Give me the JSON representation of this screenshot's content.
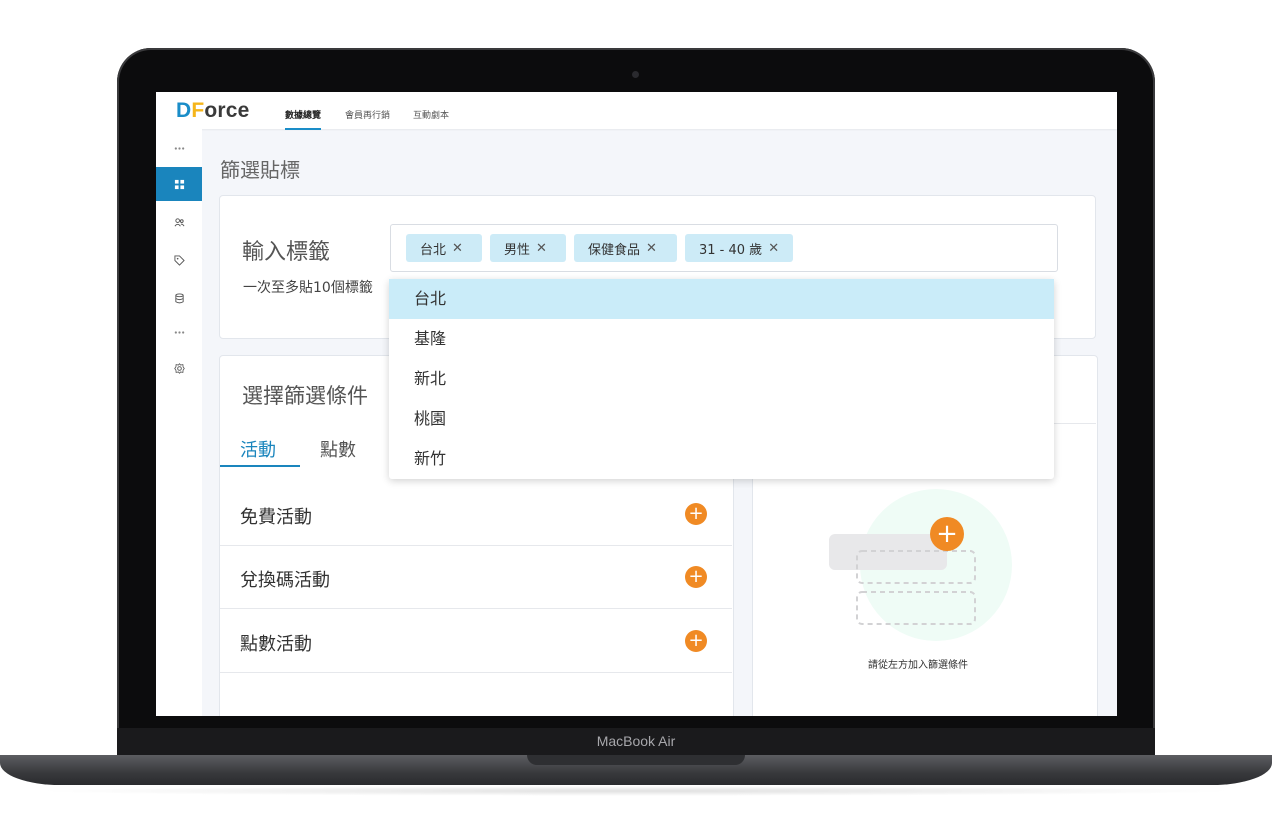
{
  "device": {
    "label": "MacBook Air"
  },
  "app": {
    "logo": {
      "d": "D",
      "f": "F",
      "rest": "orce"
    },
    "nav_tabs": [
      {
        "label": "數據總覽",
        "active": true
      },
      {
        "label": "會員再行銷",
        "active": false
      },
      {
        "label": "互動劇本",
        "active": false
      }
    ],
    "sidebar": [
      "more-icon",
      "dashboard-icon",
      "users-icon",
      "tag-icon",
      "database-icon",
      "more-icon",
      "settings-icon"
    ],
    "accent": "#1a85bd"
  },
  "page": {
    "title": "篩選貼標"
  },
  "tag_input": {
    "label": "輸入標籤",
    "hint": "一次至多貼10個標籤",
    "tags": [
      "台北",
      "男性",
      "保健食品",
      "31 - 40 歲"
    ],
    "remove_glyph": "✕"
  },
  "dropdown": {
    "options": [
      "台北",
      "基隆",
      "新北",
      "桃園",
      "新竹"
    ],
    "selected": "台北"
  },
  "filter": {
    "title": "選擇篩選條件",
    "tabs": [
      {
        "label": "活動",
        "active": true
      },
      {
        "label": "點數",
        "active": false
      }
    ],
    "activities": [
      "免費活動",
      "兌換碼活動",
      "點數活動"
    ],
    "add_glyph": "+"
  },
  "empty_state": {
    "caption": "請從左方加入篩選條件",
    "add_glyph": "+"
  },
  "colors": {
    "tag_bg": "#cdebf7",
    "plus": "#f08a24",
    "logo_blue": "#1a8dc8",
    "logo_yellow": "#f5b51b"
  }
}
